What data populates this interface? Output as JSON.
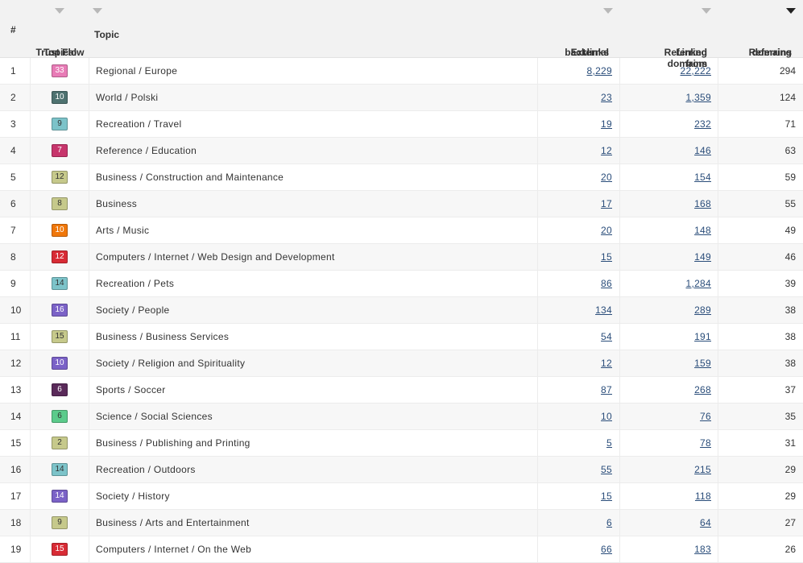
{
  "columns": {
    "num": "#",
    "ttf_line1": "Topical",
    "ttf_line2": "Trust Flow",
    "topic": "Topic",
    "ext_line1": "External",
    "ext_line2": "backlinks",
    "link_line1": "Linked from",
    "link_line2": "Referring domains",
    "ref_line1": "Referring",
    "ref_line2": "domains"
  },
  "sort": {
    "active_column": "Referring domains",
    "direction": "descending"
  },
  "rows": [
    {
      "num": "1",
      "ttf": "33",
      "ttf_color": "#e87bb6",
      "topic": "Regional / Europe",
      "ext": "8,229",
      "linked": "22,222",
      "ref": "294"
    },
    {
      "num": "2",
      "ttf": "10",
      "ttf_color": "#4e7270",
      "topic": "World / Polski",
      "ext": "23",
      "linked": "1,359",
      "ref": "124"
    },
    {
      "num": "3",
      "ttf": "9",
      "ttf_color": "#7cc3c9",
      "topic": "Recreation / Travel",
      "ext": "19",
      "linked": "232",
      "ref": "71"
    },
    {
      "num": "4",
      "ttf": "7",
      "ttf_color": "#c7356c",
      "topic": "Reference / Education",
      "ext": "12",
      "linked": "146",
      "ref": "63"
    },
    {
      "num": "5",
      "ttf": "12",
      "ttf_color": "#c6c98b",
      "topic": "Business / Construction and Maintenance",
      "ext": "20",
      "linked": "154",
      "ref": "59"
    },
    {
      "num": "6",
      "ttf": "8",
      "ttf_color": "#c6c98b",
      "topic": "Business",
      "ext": "17",
      "linked": "168",
      "ref": "55"
    },
    {
      "num": "7",
      "ttf": "10",
      "ttf_color": "#f0770a",
      "topic": "Arts / Music",
      "ext": "20",
      "linked": "148",
      "ref": "49"
    },
    {
      "num": "8",
      "ttf": "12",
      "ttf_color": "#d82b35",
      "topic": "Computers / Internet / Web Design and Development",
      "ext": "15",
      "linked": "149",
      "ref": "46"
    },
    {
      "num": "9",
      "ttf": "14",
      "ttf_color": "#7cc3c9",
      "topic": "Recreation / Pets",
      "ext": "86",
      "linked": "1,284",
      "ref": "39"
    },
    {
      "num": "10",
      "ttf": "16",
      "ttf_color": "#7b62c7",
      "topic": "Society / People",
      "ext": "134",
      "linked": "289",
      "ref": "38"
    },
    {
      "num": "11",
      "ttf": "15",
      "ttf_color": "#c6c98b",
      "topic": "Business / Business Services",
      "ext": "54",
      "linked": "191",
      "ref": "38"
    },
    {
      "num": "12",
      "ttf": "10",
      "ttf_color": "#7b62c7",
      "topic": "Society / Religion and Spirituality",
      "ext": "12",
      "linked": "159",
      "ref": "38"
    },
    {
      "num": "13",
      "ttf": "6",
      "ttf_color": "#5a2a5a",
      "topic": "Sports / Soccer",
      "ext": "87",
      "linked": "268",
      "ref": "37"
    },
    {
      "num": "14",
      "ttf": "6",
      "ttf_color": "#5bcb8b",
      "topic": "Science / Social Sciences",
      "ext": "10",
      "linked": "76",
      "ref": "35"
    },
    {
      "num": "15",
      "ttf": "2",
      "ttf_color": "#c6c98b",
      "topic": "Business / Publishing and Printing",
      "ext": "5",
      "linked": "78",
      "ref": "31"
    },
    {
      "num": "16",
      "ttf": "14",
      "ttf_color": "#7cc3c9",
      "topic": "Recreation / Outdoors",
      "ext": "55",
      "linked": "215",
      "ref": "29"
    },
    {
      "num": "17",
      "ttf": "14",
      "ttf_color": "#7b62c7",
      "topic": "Society / History",
      "ext": "15",
      "linked": "118",
      "ref": "29"
    },
    {
      "num": "18",
      "ttf": "9",
      "ttf_color": "#c6c98b",
      "topic": "Business / Arts and Entertainment",
      "ext": "6",
      "linked": "64",
      "ref": "27"
    },
    {
      "num": "19",
      "ttf": "15",
      "ttf_color": "#d82b35",
      "topic": "Computers / Internet / On the Web",
      "ext": "66",
      "linked": "183",
      "ref": "26"
    }
  ]
}
